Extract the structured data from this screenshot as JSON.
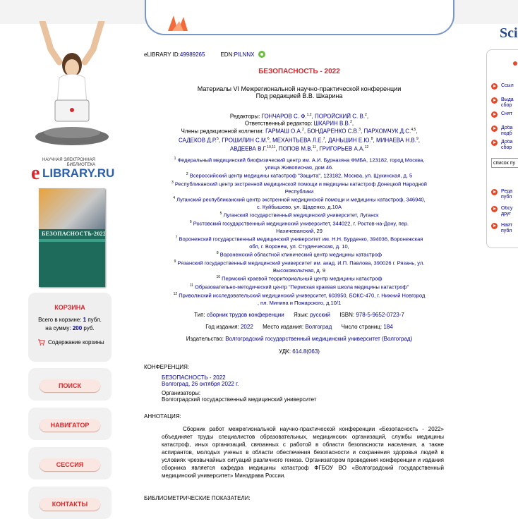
{
  "header": {
    "site_title": "Sci"
  },
  "left": {
    "logo_small_1": "НАУЧНАЯ ЭЛЕКТРОННАЯ",
    "logo_small_2": "БИБЛИОТЕКА",
    "logo_big": "LIBRARY.RU",
    "logo_e": "e",
    "book_title": "БЕЗОПАСНОСТЬ-2022",
    "cart": {
      "title": "КОРЗИНА",
      "line1_pre": "Всего в корзине: ",
      "line1_val": "1",
      "line1_post": " публ.",
      "line2_pre": "на сумму: ",
      "line2_val": "200",
      "line2_post": " руб.",
      "contents_link": "Содержание корзины"
    },
    "nav": [
      "ПОИСК",
      "НАВИГАТОР",
      "СЕССИЯ",
      "КОНТАКТЫ"
    ]
  },
  "doc": {
    "id_label": "eLIBRARY ID: ",
    "id_value": "49989265",
    "edn_label": "EDN: ",
    "edn_value": "PILNNX",
    "title": "БЕЗОПАСНОСТЬ - 2022",
    "subtitle_1": "Материалы VI Межрегиональной научно-практической конференции",
    "subtitle_2": "Под редакцией В.В. Шкарина",
    "editors_label": "Редакторы: ",
    "editor_1": "ГОНЧАРОВ С. Ф.",
    "editor_1_sup": "1,2",
    "editor_2": "ПОРОЙСКИЙ С. В.",
    "editor_2_sup": "2",
    "resp_editor_label": "Ответственный редактор: ",
    "resp_editor": "ШКАРИН В.В.",
    "resp_editor_sup": "2",
    "board_label": "Члены редакционной коллегии: ",
    "board": [
      {
        "name": "ГАРМАШ О.А.",
        "sup": "2"
      },
      {
        "name": "БОНДАРЕНКО С.В.",
        "sup": "3"
      },
      {
        "name": "ПАРХОМЧУК Д.С.",
        "sup": "4,5"
      },
      {
        "name": "САДЕКОВ Д.Р.",
        "sup": "5"
      },
      {
        "name": "ГРОШИЛИН С.М.",
        "sup": "6"
      },
      {
        "name": "МЕХАНТЬЕВА Л.Е.",
        "sup": "7"
      },
      {
        "name": "ДАНЬШИН Е.Ю.",
        "sup": "8"
      },
      {
        "name": "МИНАЕВА Н.В.",
        "sup": "9"
      },
      {
        "name": "АВДЕЕВА В.Г.",
        "sup": "10,11"
      },
      {
        "name": "ПОПОВ М.В.",
        "sup": "11"
      },
      {
        "name": "ГРИГОРЬЕВ А.А.",
        "sup": "12"
      }
    ],
    "affiliations": [
      {
        "n": "1",
        "lines": [
          "Федеральный медицинский биофизический центр им. А.И. Бурназяна ФМБА, 123182, город Москва,",
          "улица Живописная, дом 46."
        ]
      },
      {
        "n": "2",
        "lines": [
          "Всероссийский центр медицины катастроф \"Защита\", 123182, Москва, ул. Щукинская, д. 5"
        ]
      },
      {
        "n": "3",
        "lines": [
          "Республиканский центр экстренной медицинской помощи и медицины катастроф Донецкой Народной",
          "Республики"
        ]
      },
      {
        "n": "4",
        "lines": [
          "Луганский республиканский центр экстренной медицинской помощи и медицины катастроф, 346940,",
          "с. Куйбышево, ул. Щаденко, д.10А"
        ]
      },
      {
        "n": "5",
        "lines": [
          "Луганский государственный медицинский университет, Луганск"
        ]
      },
      {
        "n": "6",
        "lines": [
          "Ростовский государственный медицинский университет, 344022, г. Ростов-на-Дону, пер.",
          "Нахичеванский, 29"
        ]
      },
      {
        "n": "7",
        "lines": [
          "Воронежский государственный медицинский университет им. Н.Н. Бурденко, 394036, Воронежская",
          "обл, г. Воронеж, ул. Студенческая, д. 10,"
        ]
      },
      {
        "n": "8",
        "lines": [
          "Воронежский областной клинический центр медицины катастроф"
        ]
      },
      {
        "n": "9",
        "lines": [
          "Рязанский государственный медицинский университет им. акад. И.П. Павлова, 390026 г. Рязань, ул.",
          "Высоковольтная, д. 9"
        ]
      },
      {
        "n": "10",
        "lines": [
          "Пермский краевой территориальный центр медицины катастроф"
        ]
      },
      {
        "n": "11",
        "lines": [
          "Образовательно-методический центр \"Пермская краевая школа медицины катастроф\""
        ]
      },
      {
        "n": "12",
        "lines": [
          "Приволжский исследовательский медицинский университет, 603950, БОКС-470, г. Нижний Новгород",
          ", пл. Минина и Пожарского, д.10/1"
        ]
      }
    ],
    "meta": {
      "type_label": "Тип: ",
      "type_value": "сборник трудов конференции",
      "lang_label": "Язык: ",
      "lang_value": "русский",
      "isbn_label": "ISBN: ",
      "isbn_value": "978-5-9652-0723-7",
      "year_label": "Год издания: ",
      "year_value": "2022",
      "place_label": "Место издания: ",
      "place_value": "Волгоград",
      "pages_label": "Число страниц: ",
      "pages_value": "184",
      "publisher_label": "Издательство: ",
      "publisher_value": "Волгоградский государственный медицинский университет (Волгоград)",
      "udk_label": "УДК: ",
      "udk_value": "614.8(063)"
    },
    "conference": {
      "heading": "КОНФЕРЕНЦИЯ:",
      "name": "БЕЗОПАСНОСТЬ - 2022",
      "place_date": "Волгоград, 26 октября 2022 г.",
      "org_label": "Организаторы:",
      "org_value": "Волгоградский государственный медицинский университет"
    },
    "annotation": {
      "heading": "АННОТАЦИЯ:",
      "text": "Сборник работ межрегиональной научно-практической конференции «Безопасность - 2022» объединяет труды специалистов образовательных, медицинских организаций, службы медицины катастроф, иных организаций, связанных с работой в области безопасности населения, а также аспирантов, молодых ученых в области обеспечения безопасности и сохранения здоровья людей в условиях чрезвычайных ситуаций различного генеза. Организатором проведения конференции и издания сборника является кафедра медицины катастроф ФГБОУ ВО «Волгоградский государственный медицинский университет» Минздрава России."
    },
    "biblio_heading": "БИБЛИОМЕТРИЧЕСКИЕ ПОКАЗАТЕЛИ:"
  },
  "right": {
    "items_top": [
      "Ссыл",
      "Выда сбор",
      "Снят",
      "Доба подб",
      "Доба сбор"
    ],
    "select_value": "список пу",
    "items_bottom": [
      "Реда публ",
      "Обсу друг",
      "Найт публ"
    ]
  }
}
